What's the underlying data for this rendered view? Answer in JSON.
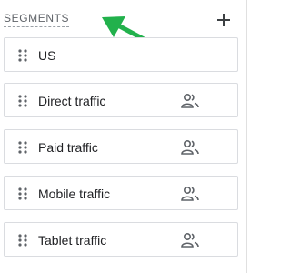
{
  "segments": {
    "title": "SEGMENTS",
    "add_icon": "plus-icon",
    "annotation_color": "#22b14c",
    "items": [
      {
        "label": "US",
        "shared": false
      },
      {
        "label": "Direct traffic",
        "shared": true
      },
      {
        "label": "Paid traffic",
        "shared": true
      },
      {
        "label": "Mobile traffic",
        "shared": true
      },
      {
        "label": "Tablet traffic",
        "shared": true
      }
    ]
  }
}
